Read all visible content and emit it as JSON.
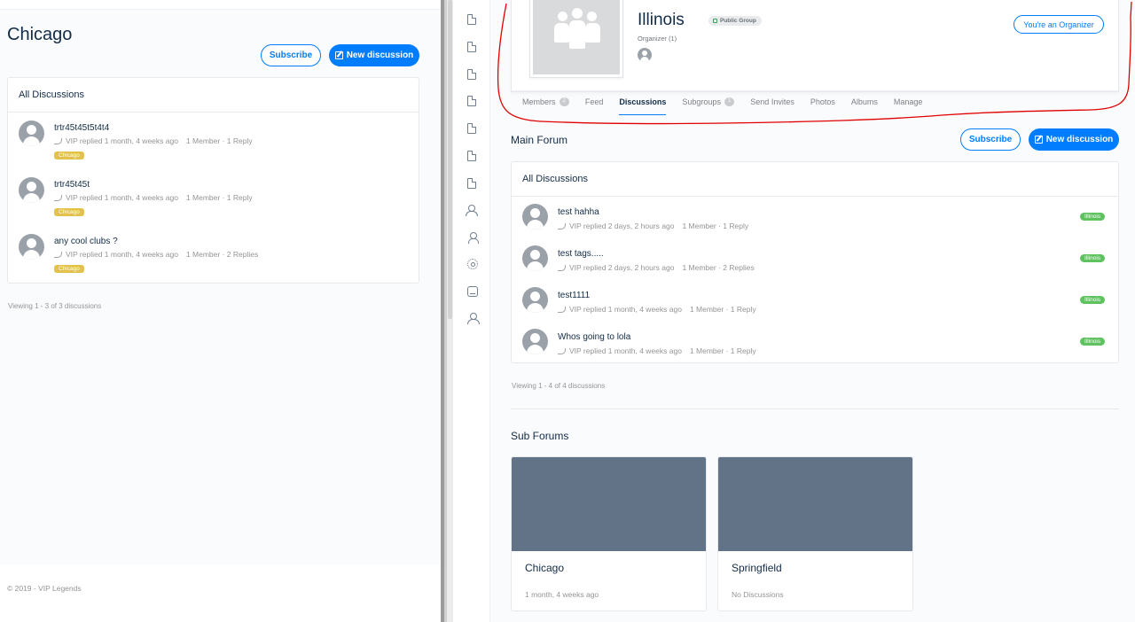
{
  "left": {
    "page_title": "Chicago",
    "subscribe_label": "Subscribe",
    "new_discussion_label": "New discussion",
    "list_header": "All Discussions",
    "discussions": [
      {
        "title": "trtr45t45t5t4t4",
        "meta": "VIP replied 1 month, 4 weeks ago",
        "counts": "1 Member · 1 Reply",
        "tag": "Chicago"
      },
      {
        "title": "trtr45t45t",
        "meta": "VIP replied 1 month, 4 weeks ago",
        "counts": "1 Member · 1 Reply",
        "tag": "Chicago"
      },
      {
        "title": "any cool clubs ?",
        "meta": "VIP replied 1 month, 4 weeks ago",
        "counts": "1 Member · 2 Replies",
        "tag": "Chicago"
      }
    ],
    "viewing": "Viewing 1 - 3 of 3 discussions",
    "footer": "© 2019 - VIP Legends"
  },
  "sidebar_icons": [
    "document-icon",
    "document-icon",
    "document-icon",
    "document-icon",
    "document-icon",
    "document-icon",
    "document-icon",
    "groups-icon",
    "user-icon",
    "gear-icon",
    "inbox-icon",
    "members-icon"
  ],
  "group": {
    "name": "Illinois",
    "badge": "Public Group",
    "organizer_text": "Organizer (1)",
    "organizer_button": "You're an Organizer",
    "tabs": [
      {
        "label": "Members",
        "count": "2"
      },
      {
        "label": "Feed",
        "count": ""
      },
      {
        "label": "Discussions",
        "count": "",
        "active": true
      },
      {
        "label": "Subgroups",
        "count": "1"
      },
      {
        "label": "Send Invites",
        "count": ""
      },
      {
        "label": "Photos",
        "count": ""
      },
      {
        "label": "Albums",
        "count": ""
      },
      {
        "label": "Manage",
        "count": ""
      }
    ]
  },
  "main_forum": {
    "title": "Main Forum",
    "subscribe_label": "Subscribe",
    "new_discussion_label": "New discussion",
    "list_header": "All Discussions",
    "discussions": [
      {
        "title": "test hahha",
        "meta": "VIP replied 2 days, 2 hours ago",
        "counts": "1 Member · 1 Reply",
        "tag": "Illinois"
      },
      {
        "title": "test tags.....",
        "meta": "VIP replied 2 days, 2 hours ago",
        "counts": "1 Member · 2 Replies",
        "tag": "Illinois"
      },
      {
        "title": "test1111",
        "meta": "VIP replied 1 month, 4 weeks ago",
        "counts": "1 Member · 1 Reply",
        "tag": "Illinois"
      },
      {
        "title": "Whos going to lola",
        "meta": "VIP replied 1 month, 4 weeks ago",
        "counts": "1 Member · 1 Reply",
        "tag": "Illinois"
      }
    ],
    "viewing": "Viewing 1 - 4 of 4 discussions"
  },
  "sub_forums": {
    "title": "Sub Forums",
    "items": [
      {
        "name": "Chicago",
        "info": "1 month, 4 weeks ago"
      },
      {
        "name": "Springfield",
        "info": "No Discussions"
      }
    ]
  },
  "colors": {
    "accent": "#007cff",
    "tag_yellow": "#e2c14c",
    "tag_green": "#5ec25f",
    "annotation": "#e00000",
    "cover": "#637387"
  }
}
